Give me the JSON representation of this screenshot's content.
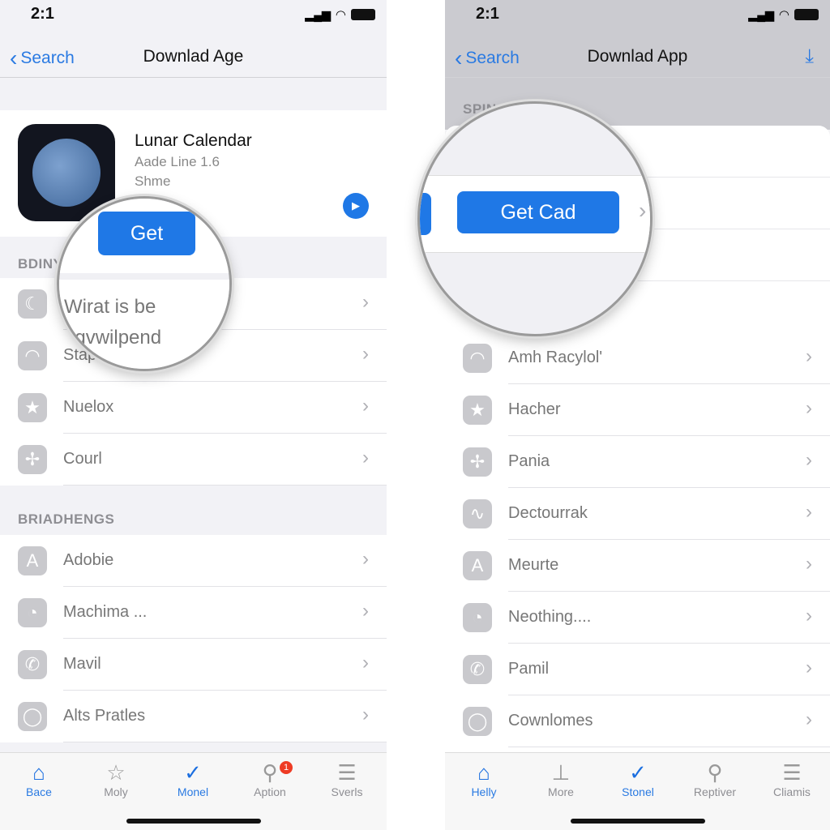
{
  "left": {
    "status": {
      "time": "2:1"
    },
    "nav": {
      "back": "Search",
      "title": "Downlad Age"
    },
    "app": {
      "name": "Lunar Calendar",
      "line1": "Aade Line 1.6",
      "line2": "Shme",
      "get": "Get"
    },
    "magnifier": {
      "button": "Get",
      "text1": "Wirat is be",
      "text2": "egvwilpend"
    },
    "section1": "BDINY",
    "rows1": [
      {
        "label": "",
        "icon": "moon-icon",
        "glyph": "☾"
      },
      {
        "label": "Stap",
        "icon": "dome-icon",
        "glyph": "◠"
      },
      {
        "label": "Nuelox",
        "icon": "star-icon",
        "glyph": "★"
      },
      {
        "label": "Courl",
        "icon": "windmill-icon",
        "glyph": "✢"
      }
    ],
    "section2": "BRIADHENGS",
    "rows2": [
      {
        "label": "Adobie",
        "icon": "adobe-icon",
        "glyph": "A"
      },
      {
        "label": "Machima ...",
        "icon": "pie-icon",
        "glyph": "◔"
      },
      {
        "label": "Mavil",
        "icon": "phone-icon",
        "glyph": "✆"
      },
      {
        "label": "Alts Pratles",
        "icon": "circle-icon",
        "glyph": "◯"
      }
    ],
    "tabs": [
      {
        "label": "Bace",
        "icon": "home-icon",
        "glyph": "⌂",
        "active": true
      },
      {
        "label": "Moly",
        "icon": "star-icon",
        "glyph": "☆"
      },
      {
        "label": "Monel",
        "icon": "check-icon",
        "glyph": "✓",
        "active": true
      },
      {
        "label": "Aption",
        "icon": "search-icon",
        "glyph": "⚲",
        "badge": "1"
      },
      {
        "label": "Sverls",
        "icon": "menu-icon",
        "glyph": "☰"
      }
    ]
  },
  "right": {
    "status": {
      "time": "2:1"
    },
    "nav": {
      "back": "Search",
      "title": "Downlad App"
    },
    "section": "SPIN",
    "magnifier": {
      "button": "Get Cad"
    },
    "rows": [
      {
        "label": "Amh Racylol'",
        "icon": "dome-icon",
        "glyph": "◠"
      },
      {
        "label": "Hacher",
        "icon": "star-icon",
        "glyph": "★"
      },
      {
        "label": "Pania",
        "icon": "windmill-icon",
        "glyph": "✢"
      },
      {
        "label": "Dectourrak",
        "icon": "chart-icon",
        "glyph": "∿"
      },
      {
        "label": "Meurte",
        "icon": "adobe-icon",
        "glyph": "A"
      },
      {
        "label": "Neothing....",
        "icon": "pie-icon",
        "glyph": "◔"
      },
      {
        "label": "Pamil",
        "icon": "phone-icon",
        "glyph": "✆"
      },
      {
        "label": "Cownlomes",
        "icon": "circle-icon",
        "glyph": "◯"
      }
    ],
    "tabs": [
      {
        "label": "Helly",
        "icon": "home-icon",
        "glyph": "⌂",
        "active": true
      },
      {
        "label": "More",
        "icon": "tool-icon",
        "glyph": "⊥"
      },
      {
        "label": "Stonel",
        "icon": "check-icon",
        "glyph": "✓",
        "active": true
      },
      {
        "label": "Reptiver",
        "icon": "search-icon",
        "glyph": "⚲"
      },
      {
        "label": "Cliamis",
        "icon": "menu-icon",
        "glyph": "☰"
      }
    ]
  },
  "colors": {
    "accent": "#1f78e6",
    "badge": "#ee3b24"
  }
}
